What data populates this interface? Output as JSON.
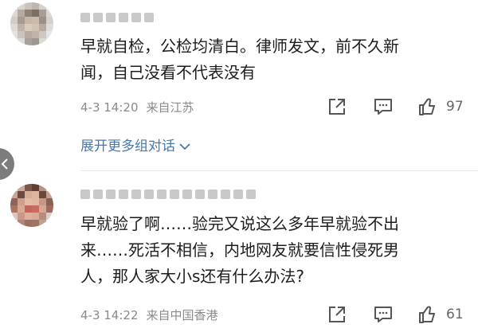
{
  "comments": [
    {
      "text_lines": [
        "早就自检，公检均清白。律师发文，前不久新",
        "闻，自己没看不代表没有"
      ],
      "date": "4-3 14:20",
      "source": "来自江苏",
      "likes": "97"
    },
    {
      "text_lines": [
        "早就验了啊……验完又说这么多年早就验不出",
        "来……死活不相信，内地网友就要信性侵死男",
        "人，那人家大小s还有什么办法?"
      ],
      "date": "4-3 14:22",
      "source": "来自中国香港",
      "likes": "61"
    }
  ],
  "expand_replies": "展开更多组对话",
  "icons": {
    "share": "share-icon",
    "comment": "comment-icon",
    "like": "thumbs-up-icon",
    "expand": "chevron-down-icon",
    "side": "chevron-left-icon"
  },
  "colors": {
    "link": "#4a77a8",
    "meta": "#8a8a8a",
    "icon": "#555555"
  }
}
